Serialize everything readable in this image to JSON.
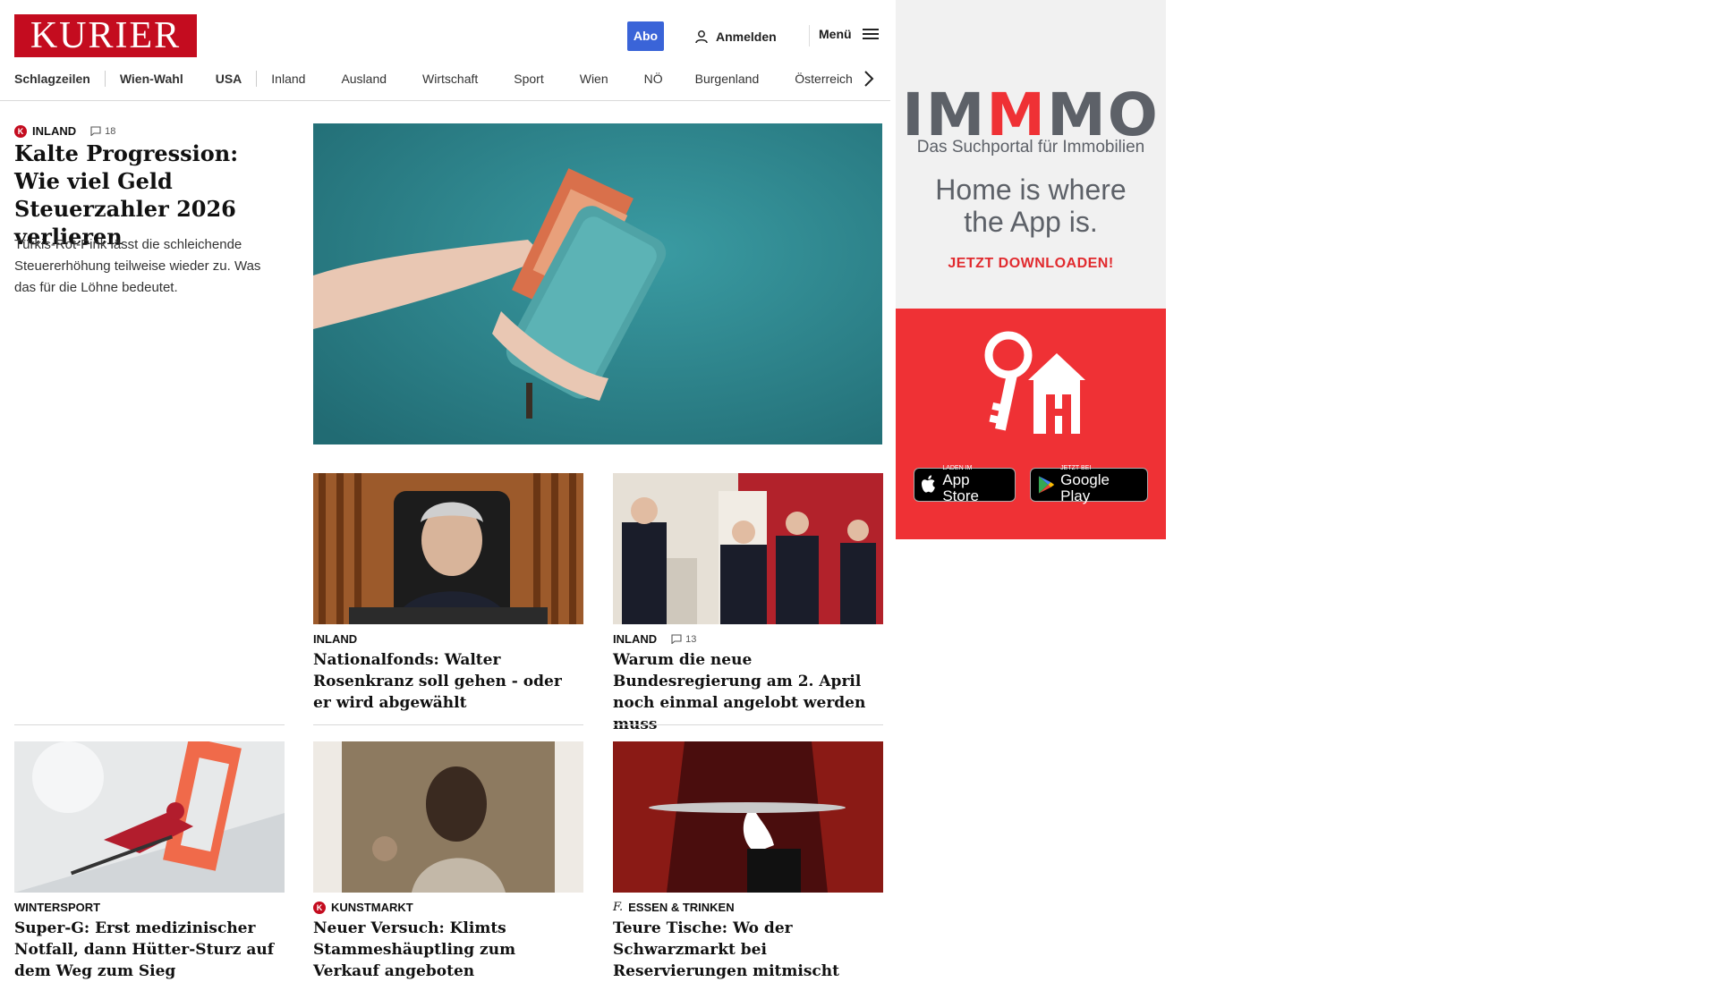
{
  "header": {
    "logo": "KURIER",
    "abo_label": "Abo",
    "login_label": "Anmelden",
    "menu_label": "Menü"
  },
  "nav": {
    "items": [
      "Schlagzeilen",
      "Wien-Wahl",
      "USA",
      "Inland",
      "Ausland",
      "Wirtschaft",
      "Sport",
      "Wien",
      "NÖ",
      "Burgenland",
      "Österreich"
    ]
  },
  "lead": {
    "badge": "K",
    "section": "INLAND",
    "comments": "18",
    "title": "Kalte Progression: Wie viel Geld Steuerzahler 2026 verlieren",
    "teaser": "Türkis-Rot-Pink lässt die schleichende Steuererhöhung teilweise wieder zu. Was das für die Löhne bedeutet."
  },
  "cards": [
    {
      "section": "INLAND",
      "comments": "",
      "title": "Nationalfonds: Walter Rosenkranz soll gehen - oder er wird abgewählt"
    },
    {
      "section": "INLAND",
      "comments": "13",
      "title": "Warum die neue Bundesregierung am 2. April noch einmal angelobt werden muss"
    },
    {
      "section": "WINTERSPORT",
      "comments": "",
      "title": "Super-G: Erst medizinischer Notfall, dann Hütter-Sturz auf dem Weg zum Sieg"
    },
    {
      "badge": "K",
      "section": "KUNSTMARKT",
      "comments": "",
      "title": "Neuer Versuch: Klimts Stammeshäuptling zum Verkauf angeboten"
    },
    {
      "badge": "f.",
      "section": "ESSEN & TRINKEN",
      "comments": "",
      "title": "Teure Tische: Wo der Schwarzmarkt bei Reservierungen mitmischt"
    }
  ],
  "ad": {
    "brand_part1": "IM",
    "brand_part2": "M",
    "brand_part3": "MO",
    "subtitle": "Das Suchportal für Immobilien",
    "claim_line1": "Home is where",
    "claim_line2": "the App is.",
    "cta": "JETZT DOWNLOADEN!",
    "appstore_small": "Laden im",
    "appstore_big": "App Store",
    "googleplay_small": "JETZT BEI",
    "googleplay_big": "Google Play",
    "brand_red": "#ef3135"
  },
  "colors": {
    "kurier_red": "#c40c1f",
    "abo_blue": "#3a64d8"
  }
}
